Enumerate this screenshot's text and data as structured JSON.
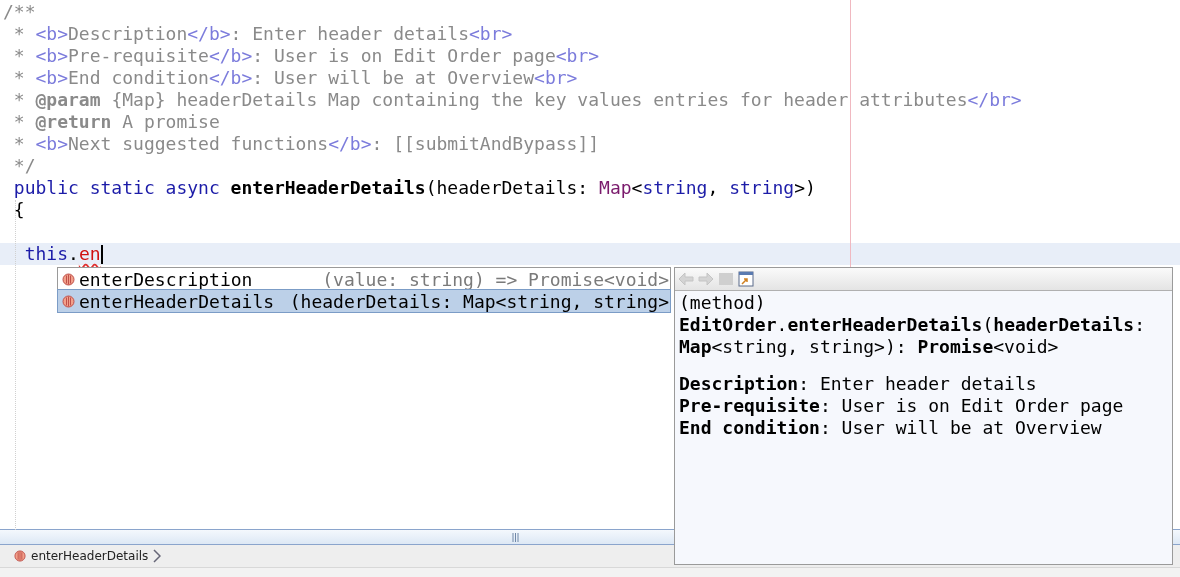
{
  "editor": {
    "lines": [
      {
        "tokens": [
          {
            "text": "/**",
            "kind": "comment"
          }
        ]
      },
      {
        "tokens": [
          {
            "text": " * ",
            "kind": "comment"
          },
          {
            "text": "<b>",
            "kind": "tag"
          },
          {
            "text": "Description",
            "kind": "comment"
          },
          {
            "text": "</b>",
            "kind": "tag"
          },
          {
            "text": ": Enter header details",
            "kind": "comment"
          },
          {
            "text": "<br>",
            "kind": "tag"
          }
        ]
      },
      {
        "tokens": [
          {
            "text": " * ",
            "kind": "comment"
          },
          {
            "text": "<b>",
            "kind": "tag"
          },
          {
            "text": "Pre-requisite",
            "kind": "comment"
          },
          {
            "text": "</b>",
            "kind": "tag"
          },
          {
            "text": ": User is on Edit Order page",
            "kind": "comment"
          },
          {
            "text": "<br>",
            "kind": "tag"
          }
        ]
      },
      {
        "tokens": [
          {
            "text": " * ",
            "kind": "comment"
          },
          {
            "text": "<b>",
            "kind": "tag"
          },
          {
            "text": "End condition",
            "kind": "comment"
          },
          {
            "text": "</b>",
            "kind": "tag"
          },
          {
            "text": ": User will be at Overview",
            "kind": "comment"
          },
          {
            "text": "<br>",
            "kind": "tag"
          }
        ]
      },
      {
        "tokens": [
          {
            "text": " * ",
            "kind": "comment"
          },
          {
            "text": "@param",
            "kind": "annotation"
          },
          {
            "text": " {Map} headerDetails Map containing the key values entries for header attributes",
            "kind": "comment"
          },
          {
            "text": "</br>",
            "kind": "tag"
          }
        ]
      },
      {
        "tokens": [
          {
            "text": " * ",
            "kind": "comment"
          },
          {
            "text": "@return",
            "kind": "annotation"
          },
          {
            "text": " A promise",
            "kind": "comment"
          }
        ]
      },
      {
        "tokens": [
          {
            "text": " * ",
            "kind": "comment"
          },
          {
            "text": "<b>",
            "kind": "tag"
          },
          {
            "text": "Next suggested functions",
            "kind": "comment"
          },
          {
            "text": "</b>",
            "kind": "tag"
          },
          {
            "text": ": [[submitAndBypass]]",
            "kind": "comment"
          }
        ]
      },
      {
        "tokens": [
          {
            "text": " */",
            "kind": "comment"
          }
        ]
      },
      {
        "tokens": [
          {
            "text": " public static async ",
            "kind": "keyword"
          },
          {
            "text": "enterHeaderDetails",
            "kind": "method"
          },
          {
            "text": "(headerDetails: ",
            "kind": "plain"
          },
          {
            "text": "Map",
            "kind": "type"
          },
          {
            "text": "<",
            "kind": "plain"
          },
          {
            "text": "string",
            "kind": "keyword"
          },
          {
            "text": ", ",
            "kind": "plain"
          },
          {
            "text": "string",
            "kind": "keyword"
          },
          {
            "text": ">)",
            "kind": "plain"
          }
        ]
      },
      {
        "tokens": [
          {
            "text": " {",
            "kind": "plain"
          }
        ]
      },
      {
        "current": false
      },
      {
        "current": true,
        "caret": true,
        "tokens": [
          {
            "text": "  this",
            "kind": "keyword"
          },
          {
            "text": ".",
            "kind": "plain"
          },
          {
            "text": "en",
            "kind": "typed"
          }
        ]
      }
    ]
  },
  "completion": {
    "items": [
      {
        "name": "enterDescription",
        "signature": "(value: string) => Promise<void>",
        "selected": false
      },
      {
        "name": "enterHeaderDetails",
        "signature": "(headerDetails: Map<string, string>",
        "selected": true
      }
    ]
  },
  "doc_popup": {
    "heading": "(method)",
    "signature": "**EditOrder**.**enterHeaderDetails**(**headerDetails**: **Map**<string, string>): **Promise**<void>",
    "details": [
      "**Description**: Enter header details",
      "**Pre-requisite**: User is on Edit Order page",
      "**End condition**: User will be at Overview"
    ]
  },
  "breadcrumb": {
    "items": [
      {
        "label": "enterHeaderDetails"
      }
    ]
  }
}
